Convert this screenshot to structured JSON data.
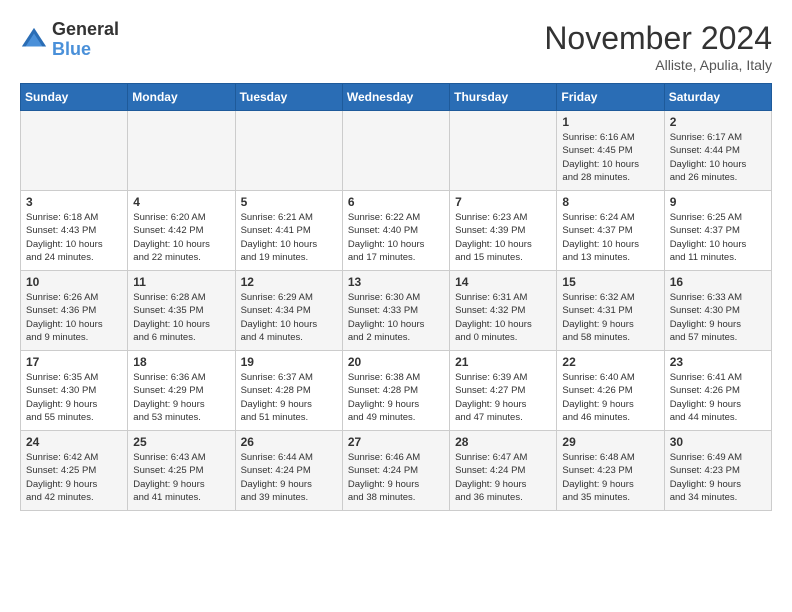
{
  "logo": {
    "general": "General",
    "blue": "Blue"
  },
  "header": {
    "month": "November 2024",
    "location": "Alliste, Apulia, Italy"
  },
  "days_of_week": [
    "Sunday",
    "Monday",
    "Tuesday",
    "Wednesday",
    "Thursday",
    "Friday",
    "Saturday"
  ],
  "weeks": [
    [
      {
        "day": "",
        "info": ""
      },
      {
        "day": "",
        "info": ""
      },
      {
        "day": "",
        "info": ""
      },
      {
        "day": "",
        "info": ""
      },
      {
        "day": "",
        "info": ""
      },
      {
        "day": "1",
        "info": "Sunrise: 6:16 AM\nSunset: 4:45 PM\nDaylight: 10 hours\nand 28 minutes."
      },
      {
        "day": "2",
        "info": "Sunrise: 6:17 AM\nSunset: 4:44 PM\nDaylight: 10 hours\nand 26 minutes."
      }
    ],
    [
      {
        "day": "3",
        "info": "Sunrise: 6:18 AM\nSunset: 4:43 PM\nDaylight: 10 hours\nand 24 minutes."
      },
      {
        "day": "4",
        "info": "Sunrise: 6:20 AM\nSunset: 4:42 PM\nDaylight: 10 hours\nand 22 minutes."
      },
      {
        "day": "5",
        "info": "Sunrise: 6:21 AM\nSunset: 4:41 PM\nDaylight: 10 hours\nand 19 minutes."
      },
      {
        "day": "6",
        "info": "Sunrise: 6:22 AM\nSunset: 4:40 PM\nDaylight: 10 hours\nand 17 minutes."
      },
      {
        "day": "7",
        "info": "Sunrise: 6:23 AM\nSunset: 4:39 PM\nDaylight: 10 hours\nand 15 minutes."
      },
      {
        "day": "8",
        "info": "Sunrise: 6:24 AM\nSunset: 4:37 PM\nDaylight: 10 hours\nand 13 minutes."
      },
      {
        "day": "9",
        "info": "Sunrise: 6:25 AM\nSunset: 4:37 PM\nDaylight: 10 hours\nand 11 minutes."
      }
    ],
    [
      {
        "day": "10",
        "info": "Sunrise: 6:26 AM\nSunset: 4:36 PM\nDaylight: 10 hours\nand 9 minutes."
      },
      {
        "day": "11",
        "info": "Sunrise: 6:28 AM\nSunset: 4:35 PM\nDaylight: 10 hours\nand 6 minutes."
      },
      {
        "day": "12",
        "info": "Sunrise: 6:29 AM\nSunset: 4:34 PM\nDaylight: 10 hours\nand 4 minutes."
      },
      {
        "day": "13",
        "info": "Sunrise: 6:30 AM\nSunset: 4:33 PM\nDaylight: 10 hours\nand 2 minutes."
      },
      {
        "day": "14",
        "info": "Sunrise: 6:31 AM\nSunset: 4:32 PM\nDaylight: 10 hours\nand 0 minutes."
      },
      {
        "day": "15",
        "info": "Sunrise: 6:32 AM\nSunset: 4:31 PM\nDaylight: 9 hours\nand 58 minutes."
      },
      {
        "day": "16",
        "info": "Sunrise: 6:33 AM\nSunset: 4:30 PM\nDaylight: 9 hours\nand 57 minutes."
      }
    ],
    [
      {
        "day": "17",
        "info": "Sunrise: 6:35 AM\nSunset: 4:30 PM\nDaylight: 9 hours\nand 55 minutes."
      },
      {
        "day": "18",
        "info": "Sunrise: 6:36 AM\nSunset: 4:29 PM\nDaylight: 9 hours\nand 53 minutes."
      },
      {
        "day": "19",
        "info": "Sunrise: 6:37 AM\nSunset: 4:28 PM\nDaylight: 9 hours\nand 51 minutes."
      },
      {
        "day": "20",
        "info": "Sunrise: 6:38 AM\nSunset: 4:28 PM\nDaylight: 9 hours\nand 49 minutes."
      },
      {
        "day": "21",
        "info": "Sunrise: 6:39 AM\nSunset: 4:27 PM\nDaylight: 9 hours\nand 47 minutes."
      },
      {
        "day": "22",
        "info": "Sunrise: 6:40 AM\nSunset: 4:26 PM\nDaylight: 9 hours\nand 46 minutes."
      },
      {
        "day": "23",
        "info": "Sunrise: 6:41 AM\nSunset: 4:26 PM\nDaylight: 9 hours\nand 44 minutes."
      }
    ],
    [
      {
        "day": "24",
        "info": "Sunrise: 6:42 AM\nSunset: 4:25 PM\nDaylight: 9 hours\nand 42 minutes."
      },
      {
        "day": "25",
        "info": "Sunrise: 6:43 AM\nSunset: 4:25 PM\nDaylight: 9 hours\nand 41 minutes."
      },
      {
        "day": "26",
        "info": "Sunrise: 6:44 AM\nSunset: 4:24 PM\nDaylight: 9 hours\nand 39 minutes."
      },
      {
        "day": "27",
        "info": "Sunrise: 6:46 AM\nSunset: 4:24 PM\nDaylight: 9 hours\nand 38 minutes."
      },
      {
        "day": "28",
        "info": "Sunrise: 6:47 AM\nSunset: 4:24 PM\nDaylight: 9 hours\nand 36 minutes."
      },
      {
        "day": "29",
        "info": "Sunrise: 6:48 AM\nSunset: 4:23 PM\nDaylight: 9 hours\nand 35 minutes."
      },
      {
        "day": "30",
        "info": "Sunrise: 6:49 AM\nSunset: 4:23 PM\nDaylight: 9 hours\nand 34 minutes."
      }
    ]
  ]
}
